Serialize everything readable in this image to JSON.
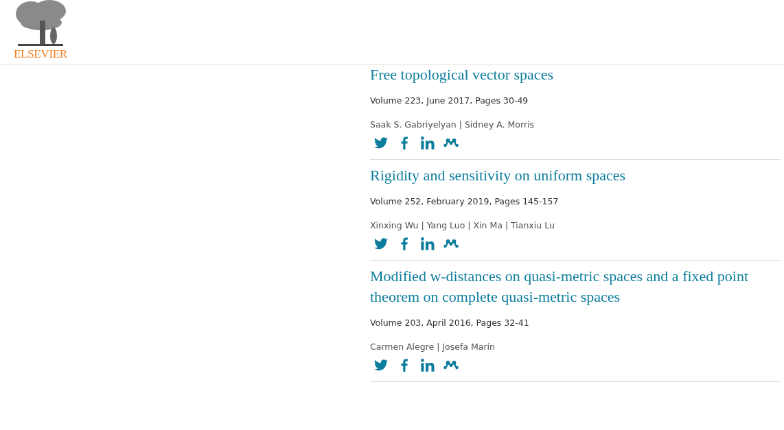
{
  "header": {
    "logo_text": "ELSEVIER"
  },
  "articles": [
    {
      "title": "Free topological vector spaces",
      "source": "Volume 223, June 2017, Pages 30-49",
      "authors": "Saak S. Gabriyelyan | Sidney A. Morris"
    },
    {
      "title": "Rigidity and sensitivity on uniform spaces",
      "source": "Volume 252, February 2019, Pages 145-157",
      "authors": "Xinxing Wu | Yang Luo | Xin Ma | Tianxiu Lu"
    },
    {
      "title": "Modified w-distances on quasi-metric spaces and a fixed point theorem on complete quasi-metric spaces",
      "source": "Volume 203, April 2016, Pages 32-41",
      "authors": "Carmen Alegre | Josefa Marín"
    }
  ]
}
